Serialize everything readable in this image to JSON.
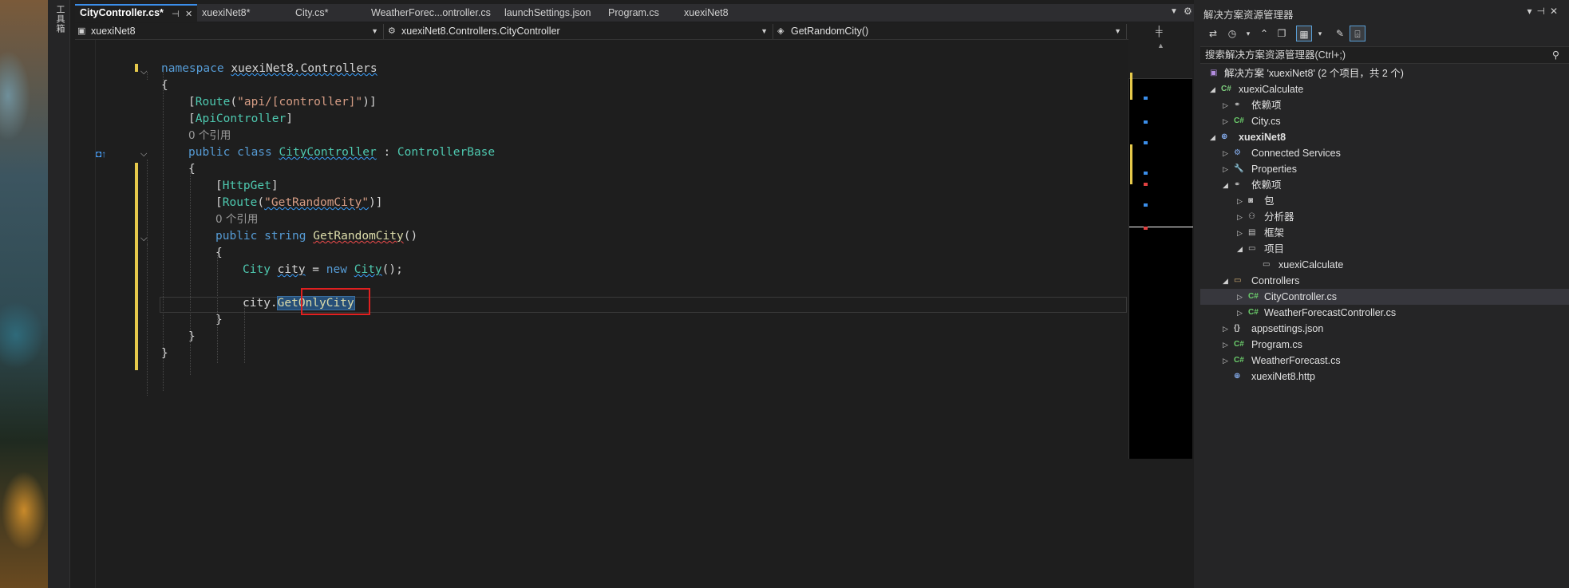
{
  "tabs": [
    {
      "label": "CityController.cs*",
      "active": true
    },
    {
      "label": "xuexiNet8*"
    },
    {
      "label": "City.cs*"
    },
    {
      "label": "WeatherForec...ontroller.cs"
    },
    {
      "label": "launchSettings.json"
    },
    {
      "label": "Program.cs"
    },
    {
      "label": "xuexiNet8"
    }
  ],
  "toolbox_label": "工具箱",
  "nav": {
    "project": "xuexiNet8",
    "type": "xuexiNet8.Controllers.CityController",
    "member": "GetRandomCity()"
  },
  "code": {
    "ns_kw": "namespace",
    "ns_name": "xuexiNet8.Controllers",
    "route_attr": "Route",
    "route_val": "\"api/[controller]\"",
    "api_attr": "ApiController",
    "refs1": "0 个引用",
    "class_kw": "public class",
    "class_name": "CityController",
    "base": "ControllerBase",
    "httpget": "HttpGet",
    "route2_val": "\"GetRandomCity\"",
    "refs2": "0 个引用",
    "method_kw": "public string",
    "method_name": "GetRandomCity",
    "type_city": "City",
    "var_city": "city",
    "new_kw": "new",
    "call_city": "city.",
    "member_call": "GetOnlyCity"
  },
  "solution_explorer": {
    "title": "解决方案资源管理器",
    "search_placeholder": "搜索解决方案资源管理器(Ctrl+;)",
    "items": [
      {
        "label": "解决方案 'xuexiNet8' (2 个项目，共 2 个)",
        "icon": "solution-icon",
        "level": 0
      },
      {
        "label": "xuexiCalculate",
        "icon": "csharp-project-icon",
        "level": 1
      },
      {
        "label": "依赖项",
        "icon": "dependencies-icon",
        "level": 2
      },
      {
        "label": "City.cs",
        "icon": "csharp-file-icon",
        "level": 2
      },
      {
        "label": "xuexiNet8",
        "icon": "web-project-icon",
        "level": 1,
        "bold": true
      },
      {
        "label": "Connected Services",
        "icon": "connected-services-icon",
        "level": 2
      },
      {
        "label": "Properties",
        "icon": "properties-icon",
        "level": 2
      },
      {
        "label": "依赖项",
        "icon": "dependencies-icon",
        "level": 2
      },
      {
        "label": "包",
        "icon": "package-icon",
        "level": 3
      },
      {
        "label": "分析器",
        "icon": "analyzer-icon",
        "level": 3
      },
      {
        "label": "框架",
        "icon": "framework-icon",
        "level": 3
      },
      {
        "label": "项目",
        "icon": "projects-icon",
        "level": 3
      },
      {
        "label": "xuexiCalculate",
        "icon": "project-ref-icon",
        "level": 4
      },
      {
        "label": "Controllers",
        "icon": "folder-icon",
        "level": 2
      },
      {
        "label": "CityController.cs",
        "icon": "csharp-file-icon",
        "level": 3,
        "selected": true
      },
      {
        "label": "WeatherForecastController.cs",
        "icon": "csharp-file-icon",
        "level": 3
      },
      {
        "label": "appsettings.json",
        "icon": "json-file-icon",
        "level": 2
      },
      {
        "label": "Program.cs",
        "icon": "csharp-file-icon",
        "level": 2
      },
      {
        "label": "WeatherForecast.cs",
        "icon": "csharp-file-icon",
        "level": 2
      },
      {
        "label": "xuexiNet8.http",
        "icon": "http-file-icon",
        "level": 2
      }
    ]
  },
  "icon_glyphs": {
    "csharp": "C#",
    "folder": "▭"
  },
  "colors": {
    "accent": "#3b8eea",
    "highlight_box": "#e02020",
    "change_bar": "#e6c94b"
  }
}
